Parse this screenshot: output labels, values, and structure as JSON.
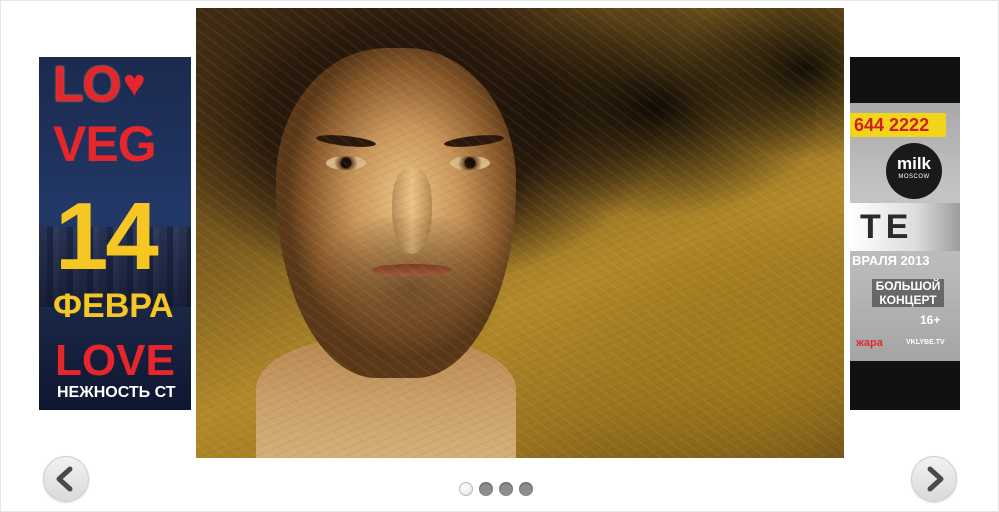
{
  "slider": {
    "left_poster": {
      "line1": "LO",
      "line2": "VEG",
      "day": "14",
      "month": "ФЕВРА",
      "title": "LOVE",
      "tagline": "НЕЖНОСТЬ СТ"
    },
    "right_poster": {
      "phone": "644 2222",
      "logo_main": "milk",
      "logo_sub": "MOSCOW",
      "title_fragment": "TE",
      "date": "ВРАЛЯ 2013",
      "concert": "БОЛЬШОЙ КОНЦЕРТ",
      "age": "16+",
      "sponsor1": "жара",
      "sponsor2": "VKLYBE.TV"
    },
    "dots": [
      {
        "active": true
      },
      {
        "active": false
      },
      {
        "active": false
      },
      {
        "active": false
      }
    ],
    "active_index": 1,
    "total": 4
  },
  "icons": {
    "prev": "chevron-left-icon",
    "next": "chevron-right-icon",
    "heart": "heart-icon"
  },
  "colors": {
    "accent_red": "#e6262b",
    "accent_yellow": "#f6c623",
    "nav_button": "#e4e4e4",
    "dot_inactive": "#8d8d8d"
  }
}
